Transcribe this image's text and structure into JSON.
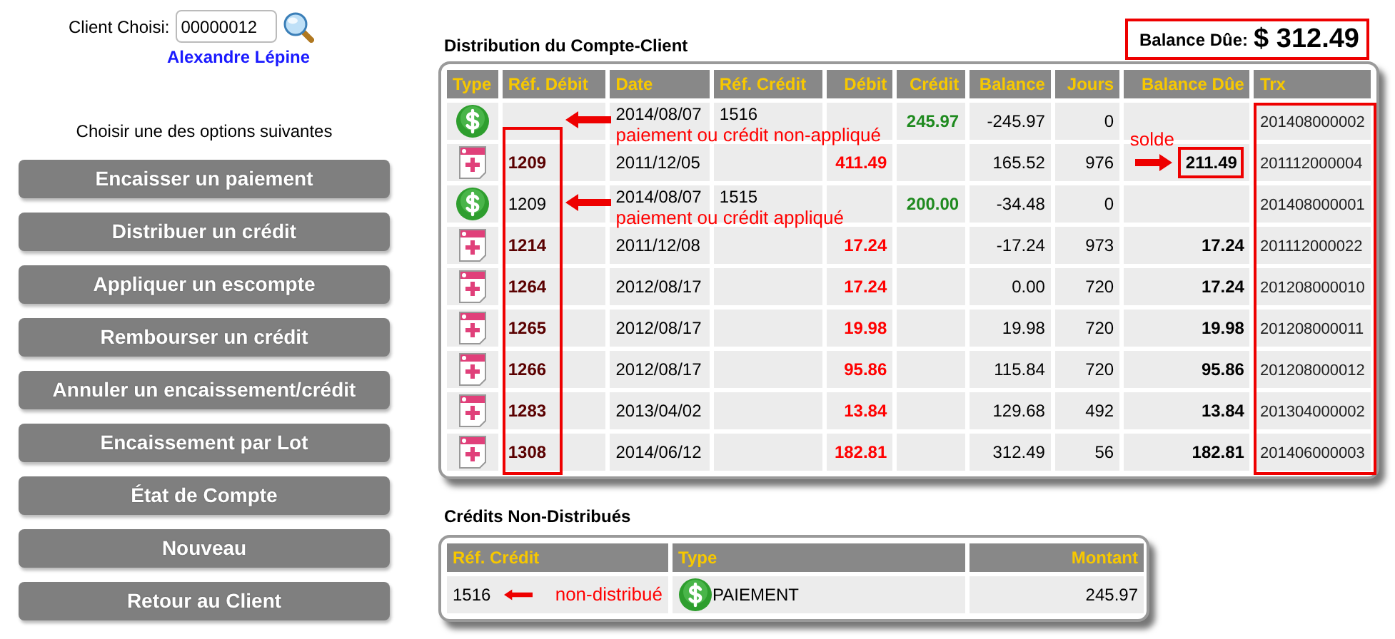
{
  "client": {
    "label": "Client Choisi:",
    "value": "00000012",
    "name": "Alexandre Lépine"
  },
  "options_prompt": "Choisir une des options suivantes",
  "buttons": [
    "Encaisser un paiement",
    "Distribuer un crédit",
    "Appliquer un escompte",
    "Rembourser un crédit",
    "Annuler un encaissement/crédit",
    "Encaissement par Lot",
    "État de Compte",
    "Nouveau",
    "Retour au Client"
  ],
  "distribution": {
    "title": "Distribution du Compte-Client",
    "balance": {
      "label": "Balance Dûe:",
      "amount": "$ 312.49",
      "outlined": true
    },
    "columns": [
      {
        "label": "Type"
      },
      {
        "label": "Réf. Débit",
        "outlined": true
      },
      {
        "label": "Date"
      },
      {
        "label": "Réf. Crédit"
      },
      {
        "label": "Débit"
      },
      {
        "label": "Crédit"
      },
      {
        "label": "Balance"
      },
      {
        "label": "Jours"
      },
      {
        "label": "Balance Dûe"
      },
      {
        "label": "Trx",
        "outlined": true
      }
    ],
    "rows": [
      {
        "kind": "payment",
        "date": "2014/08/07",
        "ref_credit": "1516",
        "credit": "245.97",
        "balance": "-245.97",
        "days": "0",
        "trx": "201408000002",
        "note": "paiement ou crédit non-appliqué"
      },
      {
        "kind": "invoice",
        "ref_debit": "1209",
        "date": "2011/12/05",
        "debit": "411.49",
        "balance": "165.52",
        "days": "976",
        "balance_due": "211.49",
        "balance_due_note": "solde",
        "trx": "201112000004"
      },
      {
        "kind": "payment",
        "ref_debit": "1209",
        "date": "2014/08/07",
        "ref_credit": "1515",
        "credit": "200.00",
        "balance": "-34.48",
        "days": "0",
        "trx": "201408000001",
        "note": "paiement ou crédit appliqué"
      },
      {
        "kind": "invoice",
        "ref_debit": "1214",
        "date": "2011/12/08",
        "debit": "17.24",
        "balance": "-17.24",
        "days": "973",
        "balance_due": "17.24",
        "trx": "201112000022"
      },
      {
        "kind": "invoice",
        "ref_debit": "1264",
        "date": "2012/08/17",
        "debit": "17.24",
        "balance": "0.00",
        "days": "720",
        "balance_due": "17.24",
        "trx": "201208000010"
      },
      {
        "kind": "invoice",
        "ref_debit": "1265",
        "date": "2012/08/17",
        "debit": "19.98",
        "balance": "19.98",
        "days": "720",
        "balance_due": "19.98",
        "trx": "201208000011"
      },
      {
        "kind": "invoice",
        "ref_debit": "1266",
        "date": "2012/08/17",
        "debit": "95.86",
        "balance": "115.84",
        "days": "720",
        "balance_due": "95.86",
        "trx": "201208000012"
      },
      {
        "kind": "invoice",
        "ref_debit": "1283",
        "date": "2013/04/02",
        "debit": "13.84",
        "balance": "129.68",
        "days": "492",
        "balance_due": "13.84",
        "trx": "201304000002"
      },
      {
        "kind": "invoice",
        "ref_debit": "1308",
        "date": "2014/06/12",
        "debit": "182.81",
        "balance": "312.49",
        "days": "56",
        "balance_due": "182.81",
        "trx": "201406000003"
      }
    ]
  },
  "undistributed": {
    "title": "Crédits Non-Distribués",
    "columns": [
      "Réf. Crédit",
      "Type",
      "Montant"
    ],
    "rows": [
      {
        "ref_credit": "1516",
        "note": "non-distribué",
        "kind": "payment",
        "type": "PAIEMENT",
        "amount": "245.97"
      }
    ]
  }
}
